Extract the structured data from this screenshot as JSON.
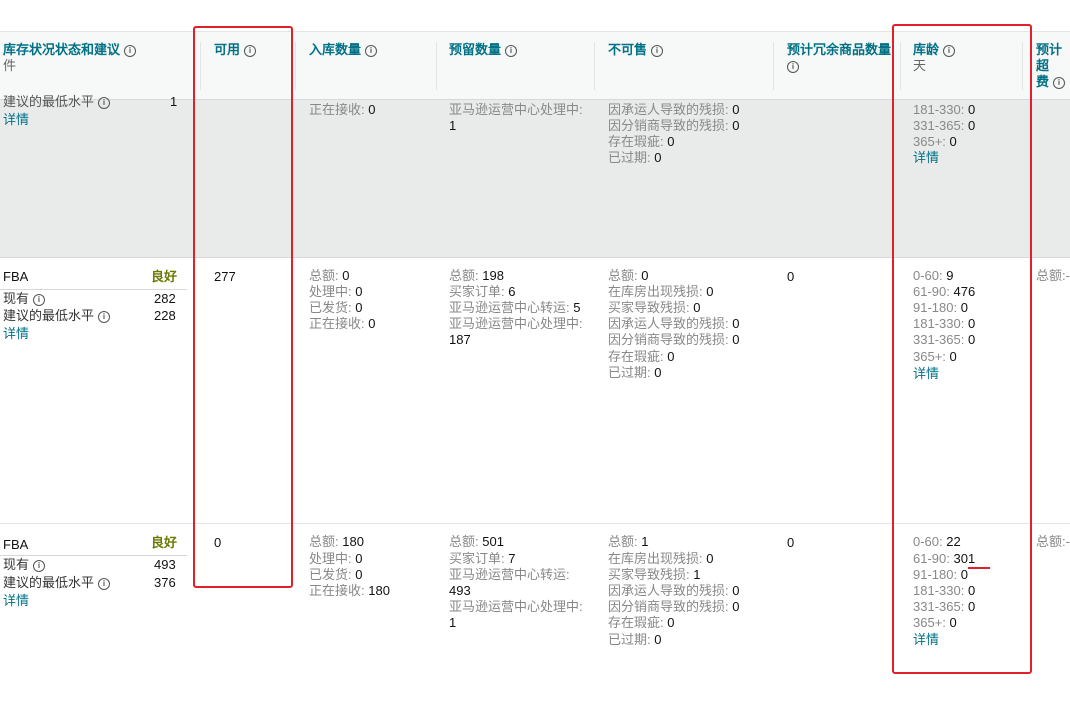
{
  "header": {
    "col_status": "库存状况状态和建议",
    "col_status_sub": "件",
    "col_available": "可用",
    "col_inbound": "入库数量",
    "col_reserved": "预留数量",
    "col_unfulfillable": "不可售",
    "col_excess": "预计冗余商品数量",
    "col_age": "库龄",
    "col_age_sub": "天",
    "col_fee": "预计超",
    "col_fee_2": "费",
    "info_glyph": "i"
  },
  "labels": {
    "fba": "FBA",
    "on_hand": "现有",
    "min_level": "建议的最低水平",
    "details": "详情",
    "total": "总额:",
    "processing": "处理中:",
    "shipped": "已发货:",
    "receiving": "正在接收:",
    "buyer_orders": "买家订单:",
    "fc_transfer": "亚马逊运营中心转运:",
    "fc_processing": "亚马逊运营中心处理中:",
    "warehouse_damaged": "在库房出现残损:",
    "customer_damaged": "买家导致残损:",
    "carrier_damaged": "因承运人导致的残损:",
    "distributor_damaged": "因分销商导致的残损:",
    "defective": "存在瑕疵:",
    "expired": "已过期:",
    "age_0_60": "0-60:",
    "age_61_90": "61-90:",
    "age_91_180": "91-180:",
    "age_181_330": "181-330:",
    "age_331_365": "331-365:",
    "age_365_plus": "365+:",
    "fee_total": "总额:-"
  },
  "rows": [
    {
      "min_level_value": "1",
      "inbound_receiving": "0",
      "reserved_fc_processing": "1",
      "unf_carrier": "0",
      "unf_distributor": "0",
      "unf_defective": "0",
      "unf_expired": "0",
      "age_181_330": "0",
      "age_331_365": "0",
      "age_365_plus": "0"
    },
    {
      "status": "良好",
      "on_hand": "282",
      "min_level": "228",
      "available": "277",
      "inbound_total": "0",
      "inbound_processing": "0",
      "inbound_shipped": "0",
      "inbound_receiving": "0",
      "reserved_total": "198",
      "reserved_buyer": "6",
      "reserved_transfer": "5",
      "reserved_fc_processing": "187",
      "unf_total": "0",
      "unf_warehouse": "0",
      "unf_customer": "0",
      "unf_carrier": "0",
      "unf_distributor": "0",
      "unf_defective": "0",
      "unf_expired": "0",
      "excess": "0",
      "age_0_60": "9",
      "age_61_90": "476",
      "age_91_180": "0",
      "age_181_330": "0",
      "age_331_365": "0",
      "age_365_plus": "0"
    },
    {
      "status": "良好",
      "on_hand": "493",
      "min_level": "376",
      "available": "0",
      "inbound_total": "180",
      "inbound_processing": "0",
      "inbound_shipped": "0",
      "inbound_receiving": "180",
      "reserved_total": "501",
      "reserved_buyer": "7",
      "reserved_transfer": "493",
      "reserved_fc_processing": "1",
      "unf_total": "1",
      "unf_warehouse": "0",
      "unf_customer": "1",
      "unf_carrier": "0",
      "unf_distributor": "0",
      "unf_defective": "0",
      "unf_expired": "0",
      "excess": "0",
      "age_0_60": "22",
      "age_61_90": "301",
      "age_91_180": "0",
      "age_181_330": "0",
      "age_331_365": "0",
      "age_365_plus": "0"
    }
  ],
  "colors": {
    "link": "#007185",
    "good": "#6b7a00",
    "highlight": "#e3202a",
    "row_selected": "#e9ebeb"
  }
}
